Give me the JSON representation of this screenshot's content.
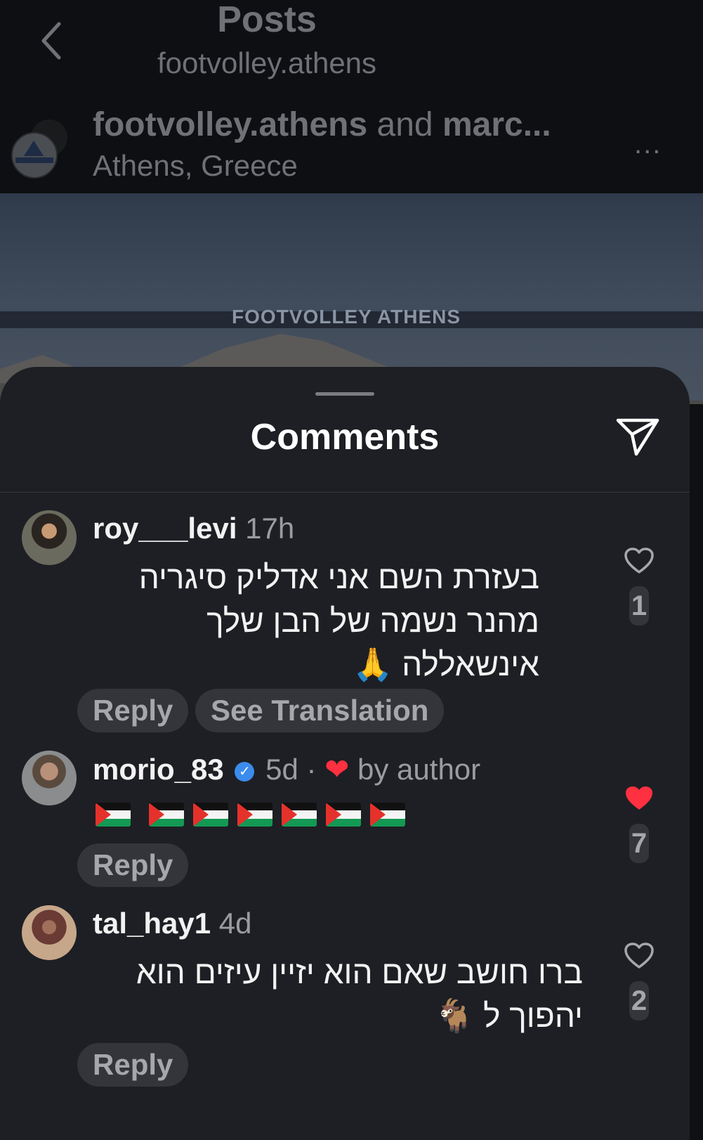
{
  "header": {
    "title": "Posts",
    "subtitle": "footvolley.athens",
    "post_author": "footvolley.athens",
    "post_author_and": " and ",
    "post_author_rest": "marc...",
    "location": "Athens, Greece",
    "more": "...",
    "logo_text": "FOOTVOLLEY"
  },
  "post_image": {
    "net_text": "FOOTVOLLEY ATHENS"
  },
  "sheet": {
    "title": "Comments"
  },
  "comments": [
    {
      "username": "roy___levi",
      "time": "17h",
      "text_lines": [
        "בעזרת השם אני אדליק סיגריה",
        "מהנר נשמה של הבן שלך",
        "אינשאללה 🙏"
      ],
      "reply_label": "Reply",
      "translate_label": "See Translation",
      "likes": "1",
      "liked": false
    },
    {
      "username": "morio_83",
      "verified_glyph": "✓",
      "time": "5d",
      "separator": "·",
      "by_author_heart": "❤",
      "by_author": "by author",
      "flag_count": 7,
      "reply_label": "Reply",
      "likes": "7",
      "liked": true
    },
    {
      "username": "tal_hay1",
      "time": "4d",
      "text_lines": [
        "ברו חושב שאם הוא יזיין עיזים הוא",
        "יהפוך ל 🐐"
      ],
      "reply_label": "Reply",
      "likes": "2",
      "liked": false
    }
  ],
  "colors": {
    "background": "#0e1013",
    "sheet": "#1d1f24",
    "pill": "#33353a",
    "like_red": "#ff3040",
    "verified_blue": "#3b8ced"
  },
  "icons": [
    "back-chevron-icon",
    "more-icon",
    "send-icon",
    "heart-icon",
    "verified-icon"
  ]
}
